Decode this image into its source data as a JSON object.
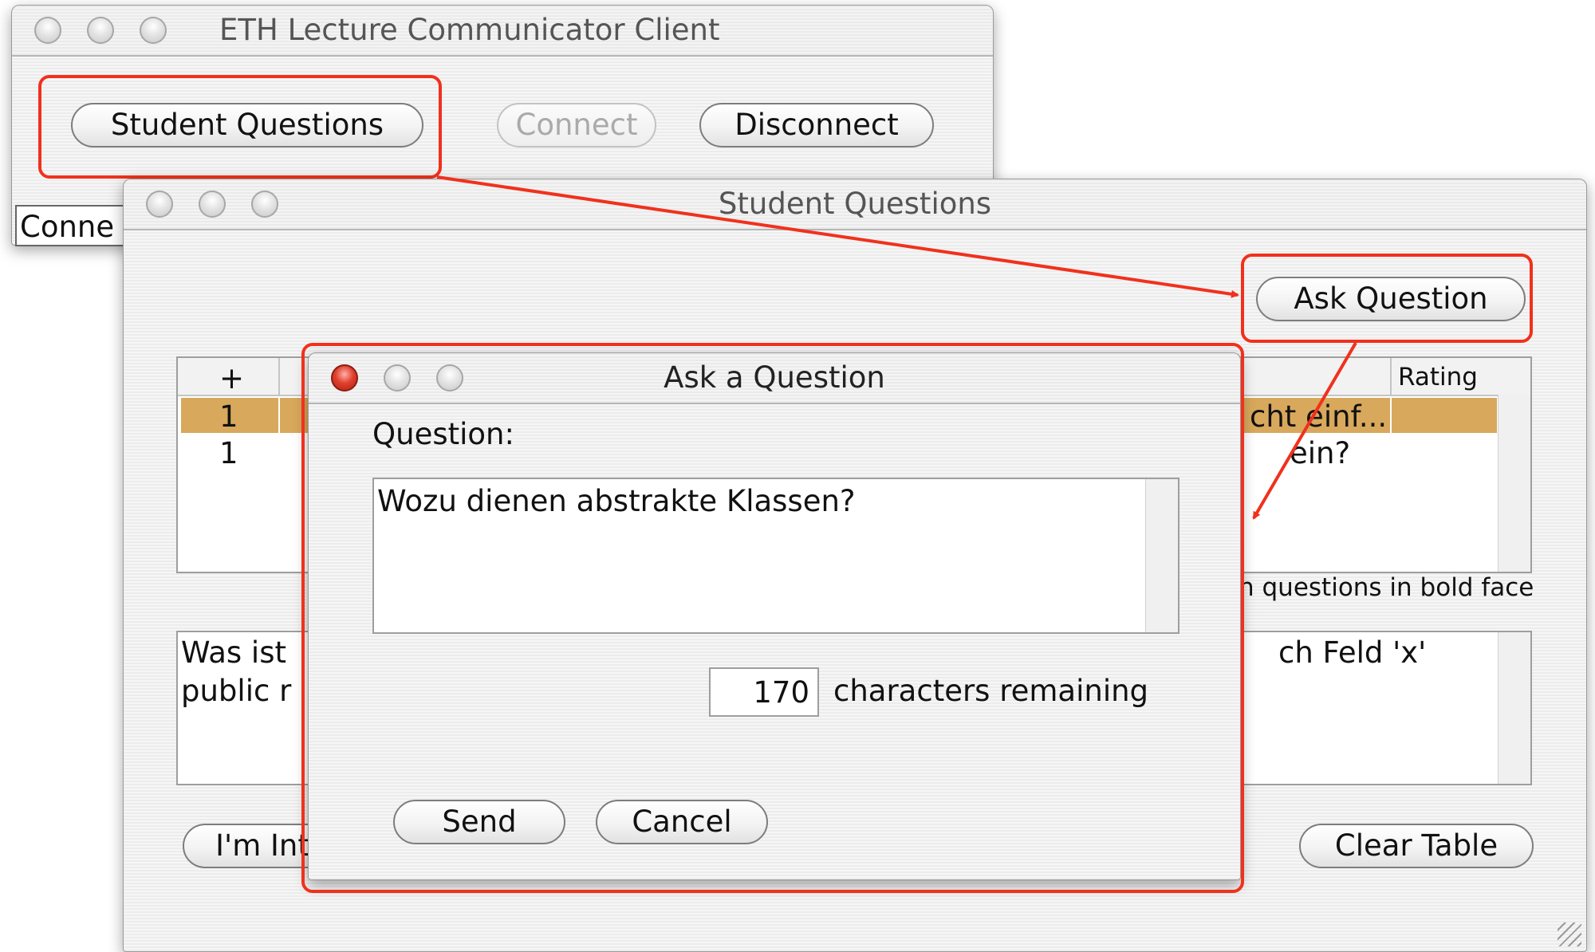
{
  "client_window": {
    "title": "ETH Lecture Communicator Client",
    "student_questions_button": "Student Questions",
    "connect_button": "Connect",
    "disconnect_button": "Disconnect",
    "status_text": "Conne"
  },
  "sq_window": {
    "title": "Student Questions",
    "ask_question_button": "Ask Question",
    "table": {
      "header_plus": "+",
      "header_rating": "Rating",
      "rows": [
        {
          "count": "1",
          "fragment": "cht einf...",
          "selected": true
        },
        {
          "count": "1",
          "fragment": "ein?",
          "selected": false
        }
      ]
    },
    "hint_fragment": "n questions in bold face",
    "preview_left_line1": "Was ist",
    "preview_left_line2": "public r",
    "preview_right_line1": "ch Feld 'x'",
    "im_button": "I'm Int",
    "clear_table_button": "Clear Table"
  },
  "ask_dialog": {
    "title": "Ask a Question",
    "question_label": "Question:",
    "question_value": "Wozu dienen abstrakte Klassen?",
    "chars_remaining_value": "170",
    "chars_remaining_label": "characters remaining",
    "send_button": "Send",
    "cancel_button": "Cancel"
  },
  "colors": {
    "highlight": "#f0311d",
    "selected_row": "#d8a85c"
  }
}
